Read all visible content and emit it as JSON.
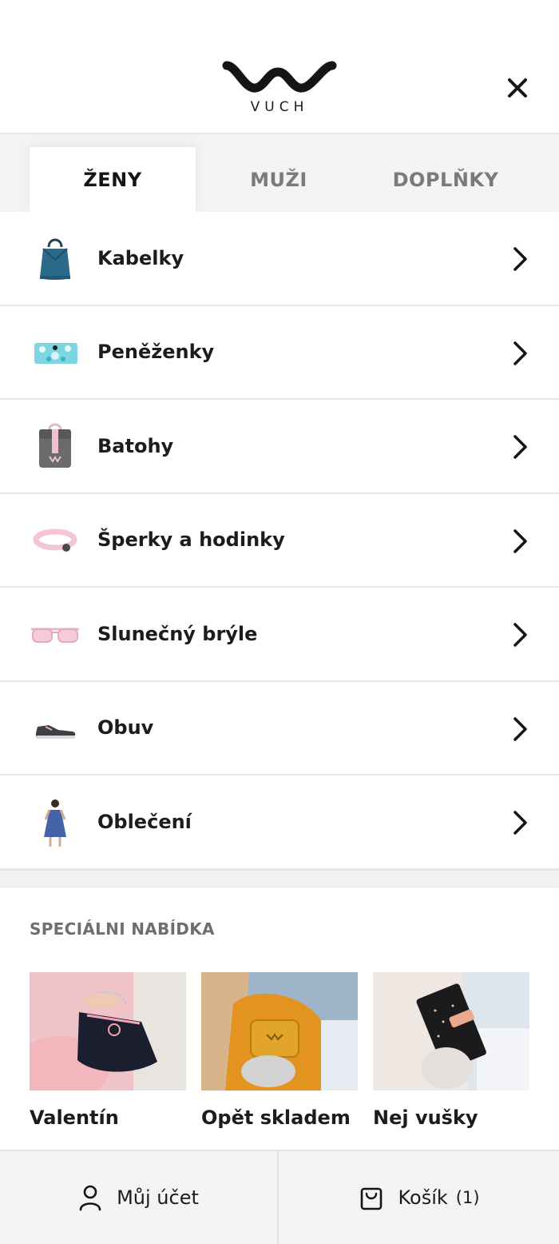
{
  "brand": {
    "name": "VUCH"
  },
  "tabs": [
    {
      "label": "ŽENY",
      "active": true
    },
    {
      "label": "MUŽI",
      "active": false
    },
    {
      "label": "DOPLŇKY",
      "active": false
    }
  ],
  "categories": [
    {
      "label": "Kabelky",
      "icon": "handbag-thumbnail"
    },
    {
      "label": "Peněženky",
      "icon": "wallet-thumbnail"
    },
    {
      "label": "Batohy",
      "icon": "backpack-thumbnail"
    },
    {
      "label": "Šperky a hodinky",
      "icon": "bracelet-thumbnail"
    },
    {
      "label": "Slunečný brýle",
      "icon": "sunglasses-thumbnail"
    },
    {
      "label": "Obuv",
      "icon": "sneaker-thumbnail"
    },
    {
      "label": "Oblečení",
      "icon": "dress-thumbnail"
    }
  ],
  "special": {
    "title": "SPECIÁLNI NABÍDKA",
    "offers": [
      {
        "label": "Valentín"
      },
      {
        "label": "Opět skladem"
      },
      {
        "label": "Nej vušky"
      }
    ]
  },
  "bottom_bar": {
    "account_label": "Můj účet",
    "cart_label": "Košík",
    "cart_count": "(1)"
  },
  "colors": {
    "text": "#1c1c1c",
    "muted": "#7a7a7a",
    "tab_bg": "#f3f3f4"
  }
}
